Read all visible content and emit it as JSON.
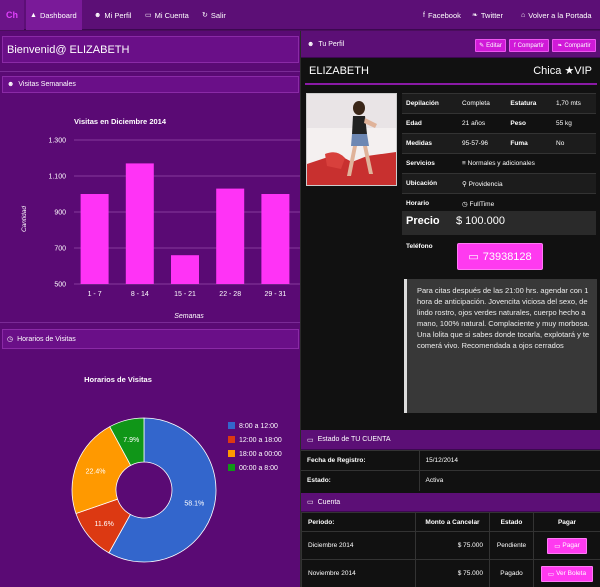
{
  "nav": {
    "brand": "Ch",
    "items": [
      {
        "icon": "dashboard-icon",
        "glyph": "▲",
        "label": "Dashboard"
      },
      {
        "icon": "user-icon",
        "glyph": "☻",
        "label": "Mi Perfil"
      },
      {
        "icon": "card-icon",
        "glyph": "▭",
        "label": "Mi Cuenta"
      },
      {
        "icon": "logout-icon",
        "glyph": "↻",
        "label": "Salir"
      }
    ],
    "right": [
      {
        "icon": "facebook-icon",
        "glyph": "f",
        "label": "Facebook"
      },
      {
        "icon": "twitter-icon",
        "glyph": "❧",
        "label": "Twitter"
      },
      {
        "icon": "home-icon",
        "glyph": "⌂",
        "label": "Volver a la Portada"
      }
    ]
  },
  "welcome": "Bienvenid@ ELIZABETH",
  "visits_panel": {
    "icon_glyph": "☻",
    "label": "Visitas Semanales"
  },
  "horarios_panel": {
    "icon_glyph": "◷",
    "label": "Horarios de Visitas"
  },
  "chart_data": [
    {
      "type": "bar",
      "title": "Visitas en Diciembre 2014",
      "xlabel": "Semanas",
      "ylabel": "Cantidad",
      "categories": [
        "1 - 7",
        "8 - 14",
        "15 - 21",
        "22 - 28",
        "29 - 31"
      ],
      "values": [
        1000,
        1170,
        660,
        1030,
        1000
      ],
      "yticks": [
        "1.300",
        "1.100",
        "900",
        "700",
        "500"
      ],
      "ytick_values": [
        1300,
        1100,
        900,
        700,
        500
      ],
      "ylim": [
        500,
        1300
      ],
      "color": "#ff33f6",
      "grid": true
    },
    {
      "type": "pie",
      "title": "Horarios de Visitas",
      "labels": [
        "8:00 a 12:00",
        "12:00 a 18:00",
        "18:00 a 00:00",
        "00:00 a 8:00"
      ],
      "values": [
        58.1,
        11.6,
        22.4,
        7.9
      ],
      "display": [
        "58.1%",
        "11.6%",
        "22.4%",
        "7.9%"
      ],
      "colors": [
        "#3366cc",
        "#dc3912",
        "#ff9900",
        "#109618"
      ],
      "donut": true,
      "legend": "right"
    }
  ],
  "profile": {
    "panel_label": "Tu Perfil",
    "buttons": [
      {
        "icon": "edit-icon",
        "glyph": "✎",
        "label": "Editar"
      },
      {
        "icon": "facebook-icon",
        "glyph": "f",
        "label": "Compartir"
      },
      {
        "icon": "twitter-icon",
        "glyph": "❧",
        "label": "Compartir"
      }
    ],
    "name": "ELIZABETH",
    "category": "Chica ★VIP",
    "attrs": [
      {
        "k1": "Depilación",
        "v1": "Completa",
        "k2": "Estatura",
        "v2": "1,70 mts"
      },
      {
        "k1": "Edad",
        "v1": "21 años",
        "k2": "Peso",
        "v2": "55 kg"
      },
      {
        "k1": "Medidas",
        "v1": "95-57-96",
        "k2": "Fuma",
        "v2": "No"
      }
    ],
    "servicios_label": "Servicios",
    "servicios": "Normales y adicionales",
    "ubicacion_label": "Ubicación",
    "ubicacion": "Providencia",
    "horario_label": "Horario",
    "horario": "FullTime",
    "precio_label": "Precio",
    "precio": "$ 100.000",
    "telefono_label": "Teléfono",
    "telefono": "73938128",
    "description": "Para citas después de las 21:00 hrs. agendar con 1 hora de anticipación. Jovencita viciosa del sexo, de lindo rostro, ojos verdes naturales, cuerpo hecho a mano, 100% natural. Complaciente y muy morbosa. Una lolita que si sabes donde tocarla, explotará y te comerá vivo. Recomendada a ojos cerrados"
  },
  "estado": {
    "panel_label": "Estado de TU CUENTA",
    "rows": [
      {
        "k": "Fecha de Registro:",
        "v": "15/12/2014"
      },
      {
        "k": "Estado:",
        "v": "Activa"
      }
    ]
  },
  "cuenta": {
    "panel_label": "Cuenta",
    "headers": [
      "Periodo:",
      "Monto a Cancelar",
      "Estado",
      "Pagar"
    ],
    "rows": [
      {
        "periodo": "Diciembre 2014",
        "monto": "$ 75.000",
        "estado": "Pendiente",
        "action": "Pagar",
        "action_glyph": "▭"
      },
      {
        "periodo": "Noviembre 2014",
        "monto": "$ 75.000",
        "estado": "Pagado",
        "action": "Ver Boleta",
        "action_glyph": "▭"
      }
    ]
  }
}
